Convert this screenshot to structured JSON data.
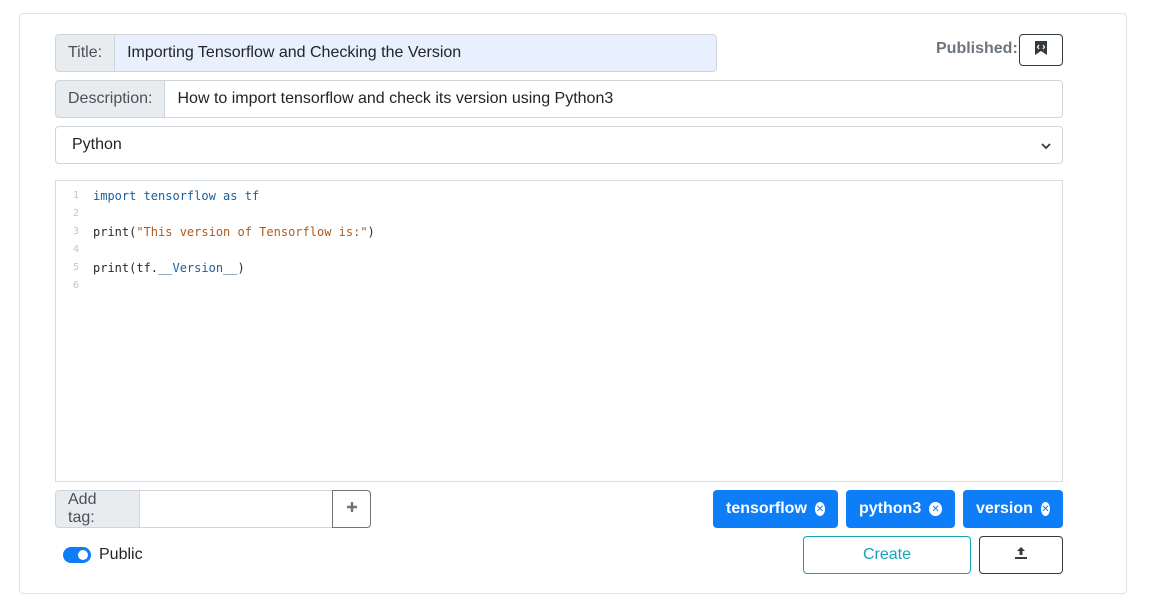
{
  "title": {
    "label": "Title:",
    "value": "Importing Tensorflow and Checking the Version"
  },
  "description": {
    "label": "Description:",
    "value": "How to import tensorflow and check its version using Python3"
  },
  "published": {
    "label": "Published:",
    "icon": "bookmark-code-icon"
  },
  "language": {
    "selected": "Python",
    "icon": "chevron-down-icon"
  },
  "editor": {
    "lines": [
      {
        "num": "1",
        "parts": [
          {
            "t": "import tensorflow as tf",
            "c": "kw"
          }
        ]
      },
      {
        "num": "2",
        "parts": []
      },
      {
        "num": "3",
        "parts": [
          {
            "t": "print(",
            "c": ""
          },
          {
            "t": "\"This version of Tensorflow is:\"",
            "c": "str"
          },
          {
            "t": ")",
            "c": ""
          }
        ]
      },
      {
        "num": "4",
        "parts": []
      },
      {
        "num": "5",
        "parts": [
          {
            "t": "print(tf.",
            "c": ""
          },
          {
            "t": "__Version__",
            "c": "kw"
          },
          {
            "t": ")",
            "c": ""
          }
        ]
      },
      {
        "num": "6",
        "parts": []
      }
    ]
  },
  "tags": {
    "add_label": "Add tag:",
    "input_value": "",
    "add_icon": "plus-icon",
    "chips": [
      {
        "label": "tensorflow"
      },
      {
        "label": "python3"
      },
      {
        "label": "version"
      }
    ],
    "remove_icon": "close-circle-icon"
  },
  "visibility": {
    "label": "Public",
    "enabled": true
  },
  "actions": {
    "create_label": "Create",
    "upload_icon": "upload-icon"
  },
  "colors": {
    "primary": "#0d7ef7",
    "info": "#17a2b8",
    "autofill": "#e8f0fe"
  }
}
